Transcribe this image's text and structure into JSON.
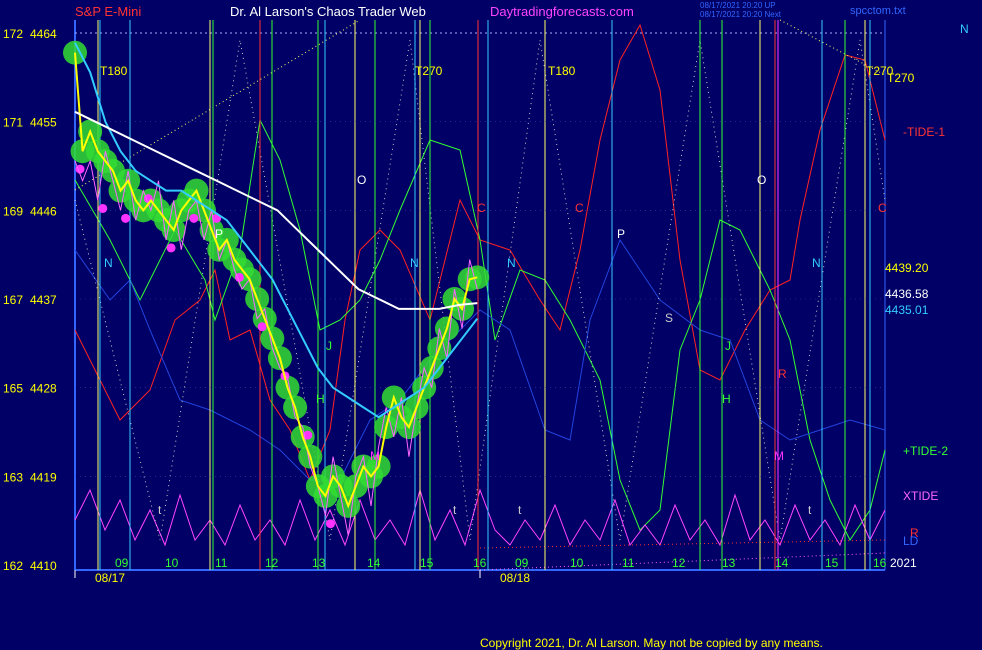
{
  "header": {
    "instrument": "S&P E-Mini",
    "site": "Dr. Al Larson's Chaos Trader Web",
    "url": "Daytradingforecasts.com",
    "stamp_line1": "08/17/2021 20:20 UP",
    "stamp_line2": "08/17/2021 20:20 Next",
    "file": "spcctom.txt",
    "copyright": "Copyright 2021, Dr. Al Larson. May not be copied by any means."
  },
  "chart_data": {
    "type": "line",
    "xlim": [
      8,
      20
    ],
    "ylim": [
      4410,
      4464
    ],
    "y_ticks": [
      {
        "left": "172",
        "price": "4464",
        "value": 4464
      },
      {
        "left": "171",
        "price": "4455",
        "value": 4455
      },
      {
        "left": "169",
        "price": "4446",
        "value": 4446
      },
      {
        "left": "167",
        "price": "4437",
        "value": 4437
      },
      {
        "left": "165",
        "price": "4428",
        "value": 4428
      },
      {
        "left": "163",
        "price": "4419",
        "value": 4419
      },
      {
        "left": "162",
        "price": "4410",
        "value": 4410
      }
    ],
    "x_hour_ticks": [
      {
        "label": "09",
        "x": 9.2
      },
      {
        "label": "10",
        "x": 10.2
      },
      {
        "label": "11",
        "x": 11.2
      },
      {
        "label": "12",
        "x": 12.2
      },
      {
        "label": "13",
        "x": 13.2
      },
      {
        "label": "14",
        "x": 14.2
      },
      {
        "label": "15",
        "x": 15.2
      },
      {
        "label": "16",
        "x": 15.95
      },
      {
        "label": "09",
        "x": 16.5
      },
      {
        "label": "10",
        "x": 17.25
      },
      {
        "label": "11",
        "x": 18.0
      },
      {
        "label": "12",
        "x": 18.75
      },
      {
        "label": "13",
        "x": 19.5
      },
      {
        "label": "14",
        "x": 20.25
      },
      {
        "label": "15",
        "x": 21.0
      },
      {
        "label": "16",
        "x": 21.7
      }
    ],
    "x_date_ticks": [
      {
        "label": "08/17",
        "x": 8.9
      },
      {
        "label": "08/18",
        "x": 16.5
      }
    ],
    "price_labels": [
      {
        "text": "4439.20",
        "value": 4439.2,
        "color": "#ffff00"
      },
      {
        "text": "4436.58",
        "value": 4436.58,
        "color": "#ffffff"
      },
      {
        "text": "4435.01",
        "value": 4435.01,
        "color": "#33ccff"
      }
    ],
    "right_legend": [
      {
        "text": "N",
        "color": "#33ccff"
      },
      {
        "text": "T270",
        "color": "#ffff00"
      },
      {
        "text": "-TIDE-1",
        "color": "#ff3333"
      },
      {
        "text": "+TIDE-2",
        "color": "#33ff33"
      },
      {
        "text": "XTIDE",
        "color": "#ff66ff"
      },
      {
        "text": "R",
        "color": "#ff3333"
      },
      {
        "text": "LD",
        "color": "#3366ff"
      },
      {
        "text": "2021",
        "color": "#ffffff"
      }
    ],
    "vertical_markers": [
      {
        "label": "T180",
        "color": "#ffff00"
      },
      {
        "label": "T270",
        "color": "#ffff00"
      },
      {
        "label": "T180",
        "color": "#ffff00"
      },
      {
        "label": "T270",
        "color": "#ffff00"
      }
    ],
    "letter_marks": [
      {
        "text": "N",
        "color": "#33ccff"
      },
      {
        "text": "O",
        "color": "#ffffff"
      },
      {
        "text": "P",
        "color": "#ffffff"
      },
      {
        "text": "C",
        "color": "#ff3333"
      },
      {
        "text": "S",
        "color": "#cccccc"
      },
      {
        "text": "J",
        "color": "#33ff33"
      },
      {
        "text": "H",
        "color": "#33ff33"
      },
      {
        "text": "M",
        "color": "#ff33ff"
      },
      {
        "text": "R",
        "color": "#ff3333"
      },
      {
        "text": "t",
        "color": "#cccccc"
      }
    ],
    "series": [
      {
        "color": "#ffff00",
        "x": [
          8.0,
          8.15,
          8.3,
          8.45,
          8.6,
          8.75,
          8.9,
          9.05,
          9.2,
          9.35,
          9.5,
          9.65,
          9.8,
          9.95,
          10.1,
          10.25,
          10.4,
          10.55,
          10.7,
          10.85,
          11.0,
          11.15,
          11.3,
          11.45,
          11.6,
          11.75,
          11.9,
          12.05,
          12.2,
          12.35,
          12.5,
          12.65,
          12.8,
          12.95,
          13.1,
          13.25,
          13.4,
          13.55,
          13.7,
          13.85,
          14.0,
          14.15,
          14.3,
          14.45,
          14.6,
          14.75,
          14.9,
          15.05,
          15.2,
          15.35,
          15.5,
          15.65,
          15.8,
          15.95
        ],
        "values": [
          4462,
          4452,
          4454,
          4452,
          4451,
          4450,
          4448,
          4449,
          4447,
          4446,
          4447,
          4446,
          4445,
          4444,
          4446,
          4447,
          4448,
          4446,
          4444,
          4442,
          4443,
          4441,
          4440,
          4439,
          4437,
          4435,
          4433,
          4431,
          4428,
          4426,
          4423,
          4421,
          4418,
          4417,
          4419,
          4418,
          4416,
          4418,
          4420,
          4419,
          4420,
          4424,
          4427,
          4425,
          4424,
          4426,
          4428,
          4430,
          4432,
          4434,
          4437,
          4436,
          4439,
          4439.2
        ]
      },
      {
        "color": "#ff66ff",
        "x": [
          8.0,
          8.15,
          8.3,
          8.45,
          8.6,
          8.75,
          8.9,
          9.05,
          9.2,
          9.35,
          9.5,
          9.65,
          9.8,
          9.95,
          10.1,
          10.25,
          10.4,
          10.55,
          10.7,
          10.85,
          11.0,
          11.15,
          11.3,
          11.45,
          11.6,
          11.75,
          11.9,
          12.05,
          12.2,
          12.35,
          12.5,
          12.65,
          12.8,
          12.95,
          13.1,
          13.25,
          13.4,
          13.55,
          13.7,
          13.85,
          14.0,
          14.15,
          14.3,
          14.45,
          14.6,
          14.75,
          14.9,
          15.05,
          15.2,
          15.35,
          15.5,
          15.65,
          15.8,
          15.95
        ],
        "values": [
          4451,
          4449,
          4451,
          4447,
          4452,
          4449,
          4446,
          4450,
          4445,
          4448,
          4446,
          4449,
          4443,
          4447,
          4442,
          4446,
          4447,
          4443,
          4446,
          4441,
          4443,
          4440,
          4438,
          4439,
          4435,
          4436,
          4432,
          4430,
          4429,
          4425,
          4424,
          4420,
          4418,
          4415,
          4421,
          4417,
          4413,
          4419,
          4421,
          4416,
          4422,
          4426,
          4423,
          4427,
          4421,
          4426,
          4430,
          4428,
          4434,
          4431,
          4438,
          4434,
          4441,
          4438
        ]
      },
      {
        "color": "#33ccff",
        "x": [
          8.0,
          8.3,
          8.6,
          8.9,
          9.2,
          9.5,
          9.8,
          10.1,
          10.4,
          10.7,
          11.0,
          11.3,
          11.6,
          11.9,
          12.2,
          12.5,
          12.8,
          13.1,
          13.4,
          13.7,
          14.0,
          14.3,
          14.6,
          14.9,
          15.2,
          15.5,
          15.8,
          15.95
        ],
        "values": [
          4463,
          4460,
          4455,
          4452,
          4450,
          4449,
          4448,
          4448,
          4447,
          4446,
          4445,
          4443,
          4441,
          4439,
          4436,
          4433,
          4430,
          4428,
          4427,
          4426,
          4425,
          4426,
          4427,
          4428,
          4430,
          4432,
          4434,
          4435.01
        ]
      },
      {
        "color": "#ffffff",
        "x": [
          8.0,
          8.4,
          8.8,
          9.2,
          9.6,
          10.0,
          10.4,
          10.8,
          11.2,
          11.6,
          12.0,
          12.4,
          12.8,
          13.2,
          13.6,
          14.0,
          14.4,
          14.8,
          15.2,
          15.6,
          15.95
        ],
        "values": [
          4456,
          4455,
          4454,
          4453,
          4452,
          4451,
          4450,
          4449,
          4448,
          4447,
          4446,
          4444,
          4442,
          4440,
          4438,
          4437,
          4436,
          4436,
          4436,
          4436.4,
          4436.58
        ]
      }
    ]
  }
}
